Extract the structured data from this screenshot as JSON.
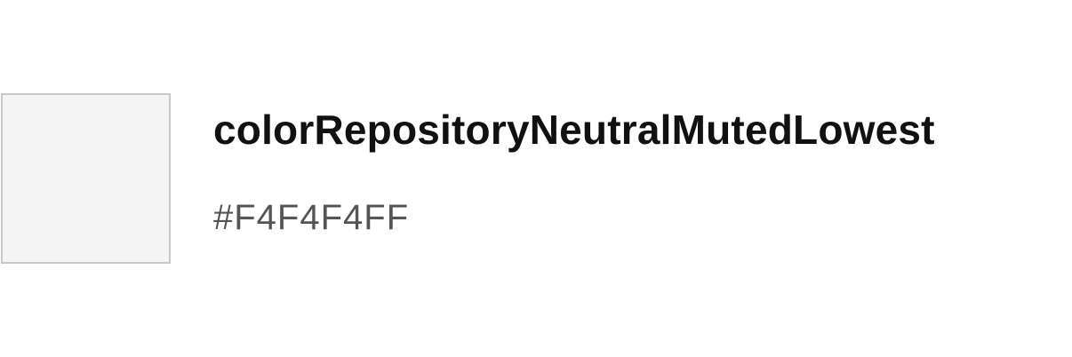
{
  "token": {
    "name": "colorRepositoryNeutralMutedLowest",
    "value": "#F4F4F4FF",
    "swatch_color": "#F4F4F4",
    "swatch_border_color": "#C8C8C8"
  }
}
